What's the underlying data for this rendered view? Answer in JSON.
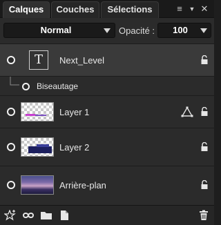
{
  "tabs": [
    {
      "label": "Calques",
      "active": true
    },
    {
      "label": "Couches",
      "active": false
    },
    {
      "label": "Sélections",
      "active": false
    }
  ],
  "tab_controls": {
    "menu_icon": "hamburger-icon",
    "collapse_icon": "chevron-down-icon",
    "close_icon": "close-icon",
    "menu_glyph": "≡",
    "collapse_glyph": "▼",
    "close_glyph": "✕"
  },
  "blend_mode": {
    "value": "Normal"
  },
  "opacity": {
    "label": "Opacité :",
    "value": "100"
  },
  "layers": [
    {
      "name": "Next_Level",
      "type": "text",
      "selected": true,
      "thumb_letter": "T",
      "locked": false
    },
    {
      "name": "Biseautage",
      "type": "effect",
      "selected": false,
      "locked": false
    },
    {
      "name": "Layer 1",
      "type": "raster",
      "selected": false,
      "locked": false,
      "vector_icon": "vector-shape-icon"
    },
    {
      "name": "Layer 2",
      "type": "raster",
      "selected": false,
      "locked": false
    },
    {
      "name": "Arrière-plan",
      "type": "background",
      "selected": false,
      "locked": false
    }
  ],
  "toolbar": {
    "icons": [
      "new-style-icon",
      "link-icon",
      "folder-icon",
      "new-layer-icon",
      "trash-icon"
    ]
  },
  "colors": {
    "panel_bg": "#2b2b2b",
    "selected_row": "#3a3a3a",
    "tab_bar": "#1a1a1a",
    "text": "#e6e6e6"
  }
}
